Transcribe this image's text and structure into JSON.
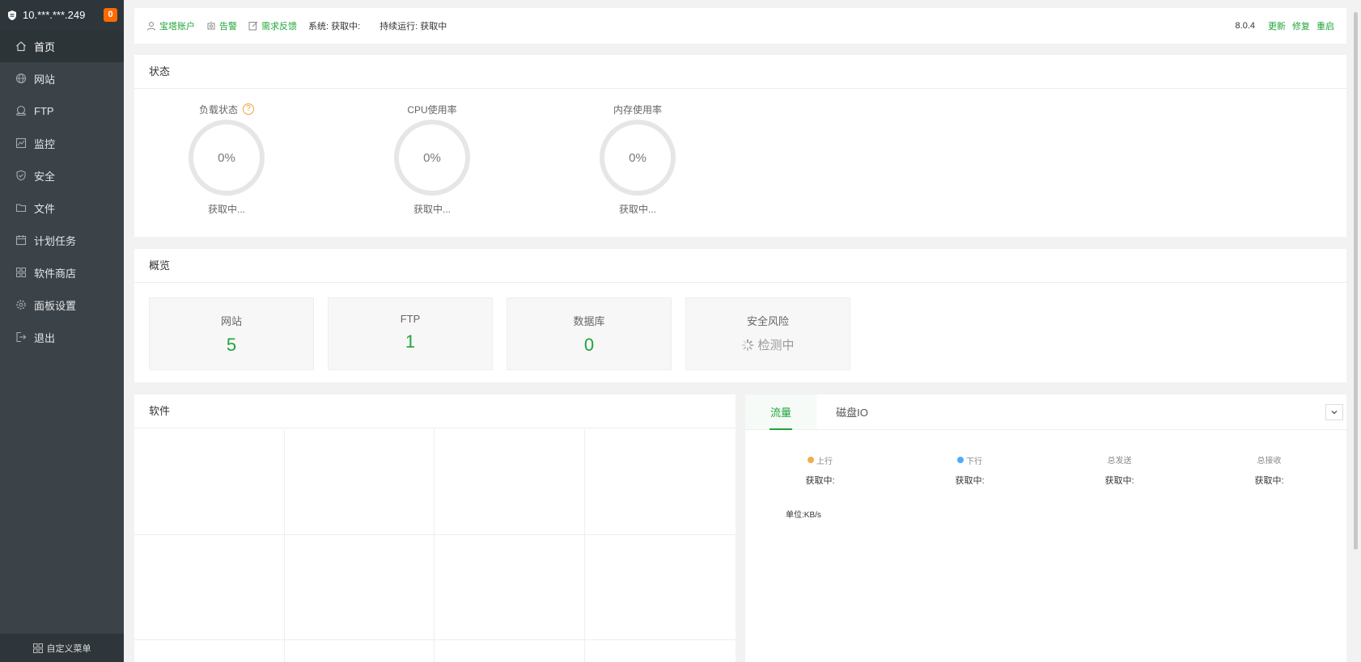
{
  "sidebar": {
    "ip": "10.***.***.249",
    "badge": "0",
    "items": [
      {
        "label": "首页",
        "icon": "home-icon"
      },
      {
        "label": "网站",
        "icon": "globe-icon"
      },
      {
        "label": "FTP",
        "icon": "ftp-icon"
      },
      {
        "label": "监控",
        "icon": "monitor-icon"
      },
      {
        "label": "安全",
        "icon": "shield-icon"
      },
      {
        "label": "文件",
        "icon": "folder-icon"
      },
      {
        "label": "计划任务",
        "icon": "calendar-icon"
      },
      {
        "label": "软件商店",
        "icon": "grid-icon"
      },
      {
        "label": "面板设置",
        "icon": "gear-icon"
      },
      {
        "label": "退出",
        "icon": "logout-icon"
      }
    ],
    "custom_menu": "自定义菜单"
  },
  "topbar": {
    "account": "宝塔账户",
    "alert": "告警",
    "feedback": "需求反馈",
    "system": "系统:  获取中:",
    "uptime": "持续运行: 获取中",
    "version": "8.0.4",
    "update": "更新",
    "repair": "修复",
    "restart": "重启"
  },
  "status": {
    "title": "状态",
    "gauges": [
      {
        "label": "负载状态",
        "value": "0%",
        "sub": "获取中..."
      },
      {
        "label": "CPU使用率",
        "value": "0%",
        "sub": "获取中..."
      },
      {
        "label": "内存使用率",
        "value": "0%",
        "sub": "获取中..."
      }
    ],
    "help": "?"
  },
  "overview": {
    "title": "概览",
    "boxes": [
      {
        "label": "网站",
        "value": "5"
      },
      {
        "label": "FTP",
        "value": "1"
      },
      {
        "label": "数据库",
        "value": "0"
      },
      {
        "label": "安全风险",
        "value": "检测中"
      }
    ]
  },
  "software": {
    "title": "软件"
  },
  "traffic": {
    "tabs": [
      "流量",
      "磁盘IO"
    ],
    "stats": [
      {
        "label": "上行",
        "value": "获取中:",
        "dot": "#f0ad4e"
      },
      {
        "label": "下行",
        "value": "获取中:",
        "dot": "#52a9ff"
      },
      {
        "label": "总发送",
        "value": "获取中:"
      },
      {
        "label": "总接收",
        "value": "获取中:"
      }
    ],
    "unit": "单位:KB/s"
  },
  "colors": {
    "accent": "#20a53a",
    "sidebar": "#3b4349",
    "badge": "#ff6a00"
  }
}
